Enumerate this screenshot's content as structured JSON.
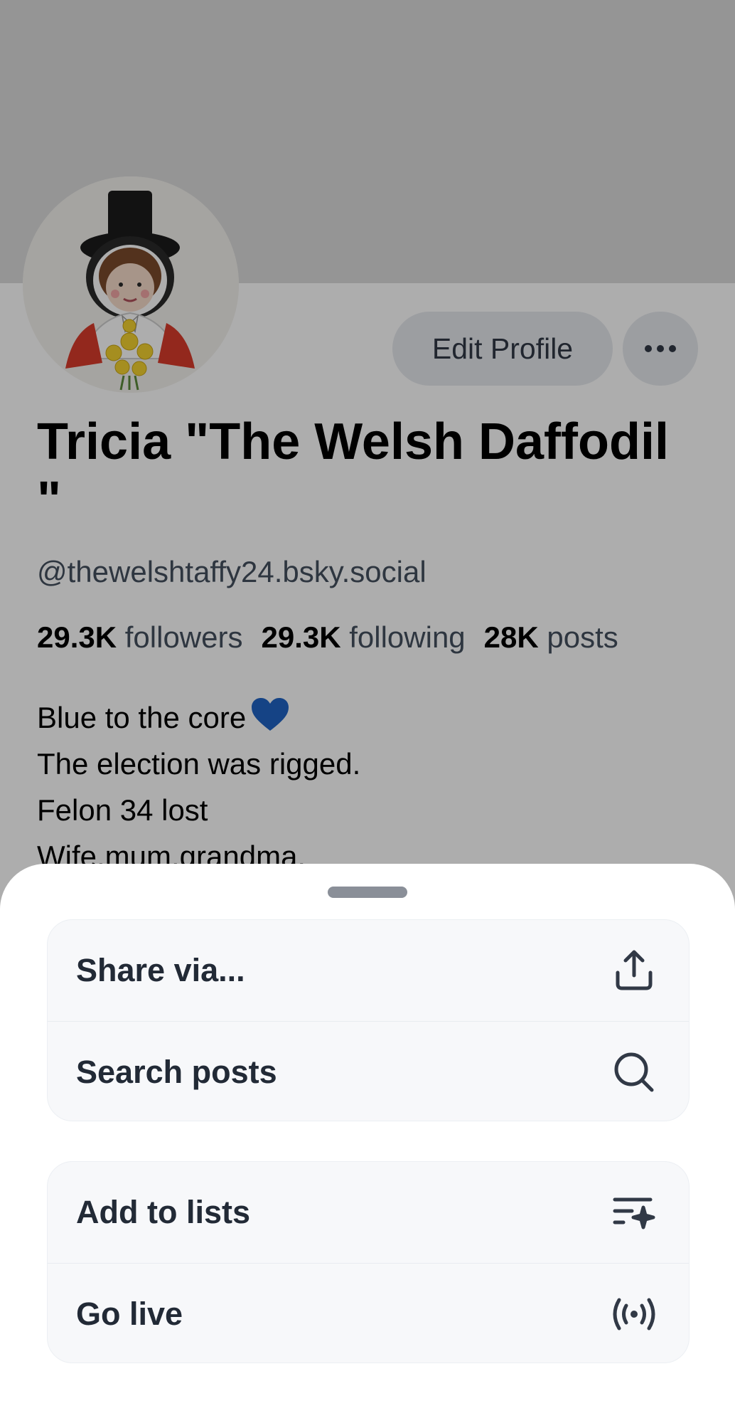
{
  "profile": {
    "display_name": "Tricia \"The Welsh Daffodil \"",
    "handle": "@thewelshtaffy24.bsky.social",
    "edit_profile_label": "Edit Profile",
    "stats": {
      "followers_count": "29.3K",
      "followers_label": "followers",
      "following_count": "29.3K",
      "following_label": "following",
      "posts_count": "28K",
      "posts_label": "posts"
    },
    "bio": {
      "line1": "Blue to the core",
      "line2": "The election was rigged.",
      "line3": "Felon 34 lost",
      "line4": "Wife.mum.grandma."
    }
  },
  "sheet": {
    "items": [
      {
        "label": "Share via...",
        "icon": "share-icon"
      },
      {
        "label": "Search posts",
        "icon": "search-icon"
      },
      {
        "label": "Add to lists",
        "icon": "list-sparkle-icon"
      },
      {
        "label": "Go live",
        "icon": "live-broadcast-icon"
      }
    ]
  },
  "colors": {
    "overlay": "rgba(0,0,0,0.32)",
    "sheet_background": "#ffffff",
    "menu_group_background": "#f7f8fa",
    "menu_text": "#222a36",
    "button_background": "#e6e9ee",
    "bio_heart": "#1f63c4"
  }
}
